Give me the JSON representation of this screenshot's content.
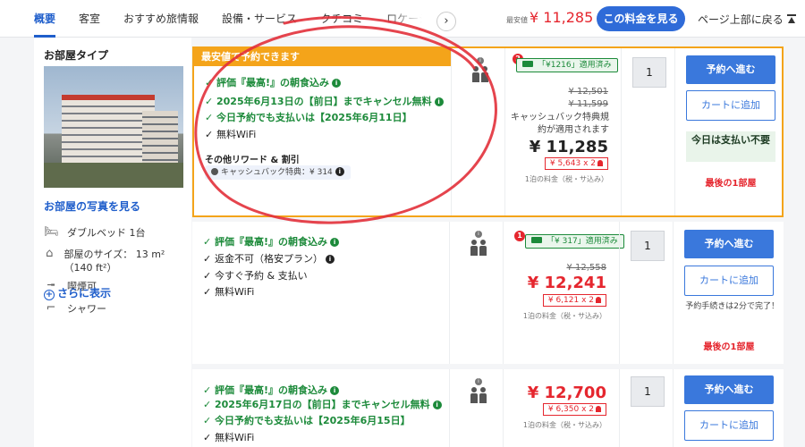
{
  "nav": {
    "tabs": [
      "概要",
      "客室",
      "おすすめ旅情報",
      "設備・サービス",
      "クチコミ",
      "ロケーション"
    ],
    "next_glyph": "›",
    "min_label": "最安値",
    "min_price": "¥ 11,285",
    "see_price_btn": "この料金を見る",
    "back_to_top": "ページ上部に戻る"
  },
  "room": {
    "type_label": "お部屋タイプ",
    "photo_link": "お部屋の写真を見る",
    "features": [
      "ダブルベッド 1台",
      "部屋のサイズ： 13 m² （140 ft²）",
      "喫煙可",
      "シャワー"
    ],
    "more_link": "さらに表示"
  },
  "offers": [
    {
      "best_label": "最安値で予約できます",
      "benefits": [
        "評価『最高!』の朝食込み",
        "2025年6月13日の【前日】までキャンセル無料",
        "今日予約でも支払いは【2025年6月11日】",
        "無料WiFi"
      ],
      "other_label": "その他リワード & 割引",
      "cashback_pill": "キャッシュバック特典：¥ 314",
      "badge": "2",
      "applied": "「¥1216」適用済み",
      "strike_prices": [
        "¥ 12,501",
        "¥ 11,599"
      ],
      "cashback_note": "キャッシュバック特典規約が適用されます",
      "price": "¥ 11,285",
      "per_person": "¥ 5,643 x 2",
      "per_night": "1泊の料金（税・サ込み）",
      "qty": "1",
      "reserve_btn": "予約へ進む",
      "cart_btn": "カートに追加",
      "pay_later": "今日は支払い不要",
      "last_room": "最後の1部屋"
    },
    {
      "benefits": [
        "評価『最高!』の朝食込み",
        "返金不可（格安プラン）",
        "今すぐ予約 & 支払い",
        "無料WiFi"
      ],
      "badge": "1",
      "applied": "「¥ 317」適用済み",
      "strike_prices": [
        "¥ 12,558"
      ],
      "price": "¥ 12,241",
      "per_person": "¥ 6,121 x 2",
      "per_night": "1泊の料金（税・サ込み）",
      "qty": "1",
      "reserve_btn": "予約へ進む",
      "cart_btn": "カートに追加",
      "fast_note": "予約手続きは2分で完了！",
      "last_room": "最後の1部屋"
    },
    {
      "benefits": [
        "評価『最高!』の朝食込み",
        "2025年6月17日の【前日】までキャンセル無料",
        "今日予約でも支払いは【2025年6月15日】",
        "無料WiFi"
      ],
      "price": "¥ 12,700",
      "per_person": "¥ 6,350 x 2",
      "per_night": "1泊の料金（税・サ込み）",
      "qty": "1",
      "reserve_btn": "予約へ進む",
      "cart_btn": "カートに追加"
    }
  ],
  "colors": {
    "accent_blue": "#3a78dc",
    "best_orange": "#f4a41a",
    "price_red": "#e5262e",
    "benefit_green": "#1c8a3a"
  }
}
